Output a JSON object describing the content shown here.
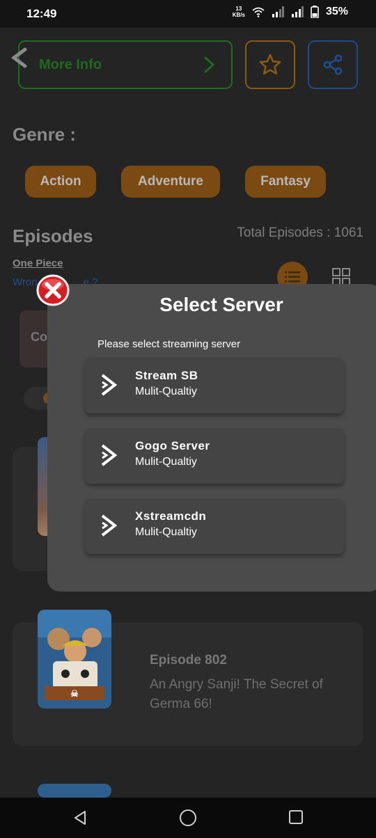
{
  "status_bar": {
    "time": "12:49",
    "net_speed_value": "13",
    "net_speed_unit": "KB/s",
    "battery": "35%"
  },
  "header": {
    "more_info_label": "More Info"
  },
  "genre": {
    "title": "Genre :",
    "tags": [
      "Action",
      "Adventure",
      "Fantasy"
    ]
  },
  "episodes": {
    "title": "Episodes",
    "total_label": "Total Episodes : 1061",
    "anime_name": "One Piece",
    "wrong_link_prefix": "Wron",
    "wrong_link_suffix": "e ?",
    "mini_card_text": "Co"
  },
  "episode_cards": [
    {
      "title": "Episode 802",
      "description": "An Angry Sanji! The Secret of Germa 66!"
    }
  ],
  "dialog": {
    "title": "Select Server",
    "subtitle": "Please select streaming server",
    "servers": [
      {
        "name": "Stream SB",
        "quality": "Mulit-Qualtiy"
      },
      {
        "name": "Gogo Server",
        "quality": "Mulit-Qualtiy"
      },
      {
        "name": "Xstreamcdn",
        "quality": "Mulit-Qualtiy"
      }
    ]
  },
  "colors": {
    "accent_orange": "#e8961e",
    "more_info_green": "#2fa82f",
    "share_blue": "#2a6fd8",
    "close_red": "#e0242a"
  }
}
